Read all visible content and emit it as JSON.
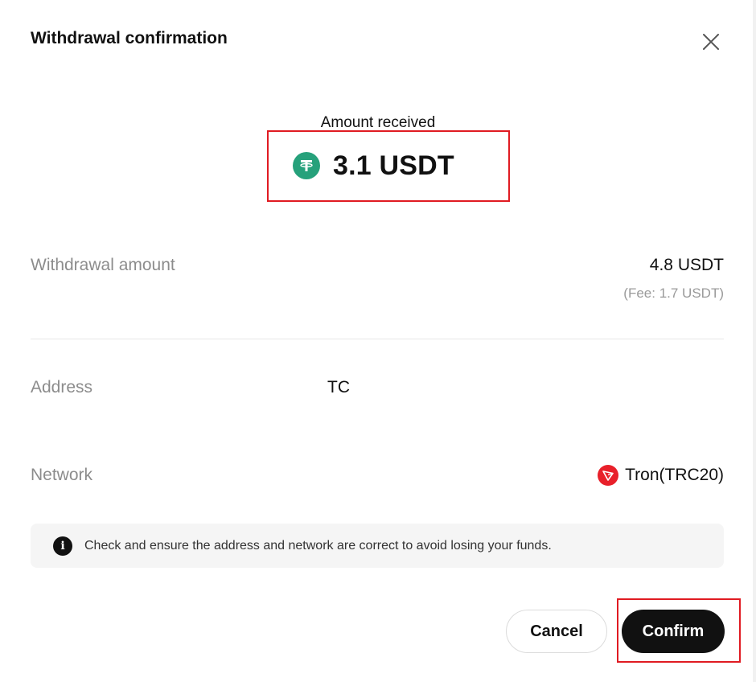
{
  "dialog": {
    "title": "Withdrawal confirmation",
    "amount_received_label": "Amount received",
    "amount_received_value": "3.1 USDT",
    "withdrawal_amount_label": "Withdrawal amount",
    "withdrawal_amount_value": "4.8 USDT",
    "fee_text": "(Fee: 1.7 USDT)",
    "address_label": "Address",
    "address_value": "TC",
    "network_label": "Network",
    "network_value": "Tron(TRC20)",
    "notice_text": "Check and ensure the address and network are correct to avoid losing your funds.",
    "cancel_label": "Cancel",
    "confirm_label": "Confirm"
  },
  "icons": {
    "close": "close-icon",
    "token": "usdt-icon",
    "network": "tron-icon",
    "info": "info-icon"
  },
  "colors": {
    "highlight_border": "#e01b22",
    "usdt_green": "#26a17b",
    "tron_red": "#e8202a",
    "confirm_bg": "#111111"
  }
}
